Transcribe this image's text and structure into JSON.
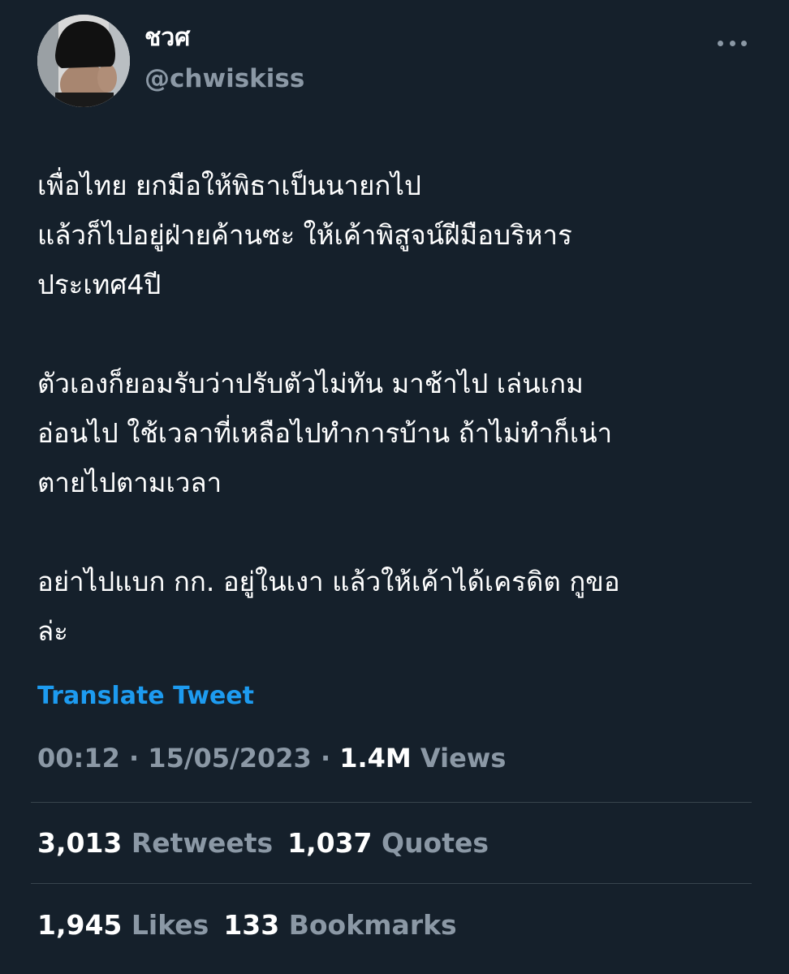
{
  "user": {
    "display_name": "ชวศ",
    "handle": "@chwiskiss"
  },
  "tweet": {
    "paragraphs": [
      "เพื่อไทย ยกมือให้พิธาเป็นนายกไป\nแล้วก็ไปอยู่ฝ่ายค้านซะ ให้เค้าพิสูจน์ฝีมือบริหาร\nประเทศ4ปี",
      "ตัวเองก็ยอมรับว่าปรับตัวไม่ทัน มาช้าไป เล่นเกม\nอ่อนไป ใช้เวลาที่เหลือไปทำการบ้าน ถ้าไม่ทำก็เน่า\nตายไปตามเวลา",
      "อย่าไปแบก กก. อยู่ในเงา แล้วให้เค้าได้เครดิต กูขอ\nล่ะ"
    ],
    "translate_label": "Translate Tweet",
    "time": "00:12",
    "separator": " · ",
    "date": "15/05/2023",
    "views_count": "1.4M",
    "views_label": "Views"
  },
  "stats": {
    "retweets_count": "3,013",
    "retweets_label": "Retweets",
    "quotes_count": "1,037",
    "quotes_label": "Quotes",
    "likes_count": "1,945",
    "likes_label": "Likes",
    "bookmarks_count": "133",
    "bookmarks_label": "Bookmarks"
  },
  "colors": {
    "background": "#15202b",
    "text_primary": "#ffffff",
    "text_secondary": "#8b98a5",
    "accent": "#1d9bf0",
    "divider": "#38444d"
  },
  "icons": {
    "more": "more-horizontal-icon"
  }
}
